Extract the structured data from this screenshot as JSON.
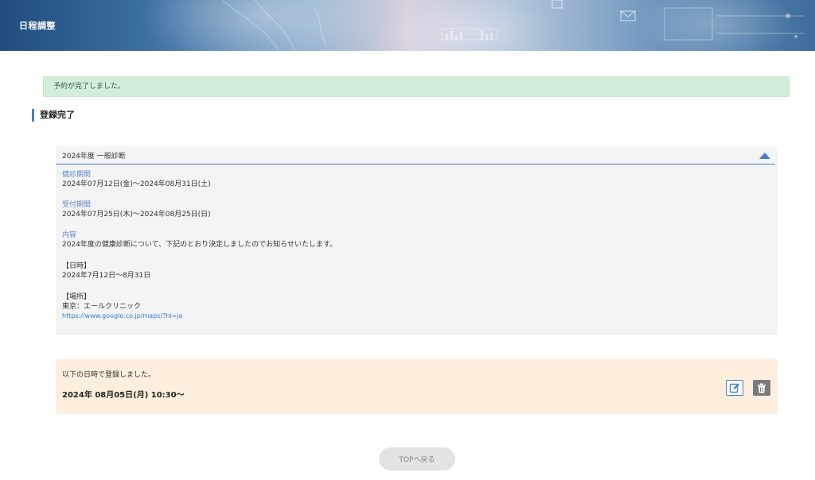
{
  "header": {
    "title": "日程調整"
  },
  "alert": {
    "message": "予約が完了しました。"
  },
  "section": {
    "title": "登録完了"
  },
  "schedule": {
    "title": "2024年度 一般診断",
    "exam_period": {
      "label": "健診期間",
      "value": "2024年07月12日(金)～2024年08月31日(土)"
    },
    "reception_period": {
      "label": "受付期間",
      "value": "2024年07月25日(木)～2024年08月25日(日)"
    },
    "content": {
      "label": "内容",
      "intro": "2024年度の健康診断について、下記のとおり決定しましたのでお知らせいたします。",
      "datetime_heading": "【日時】",
      "datetime_value": "2024年7月12日～8月31日",
      "place_heading": "【場所】",
      "place_value": "東京：エールクリニック",
      "place_link": "https://www.google.co.jp/maps/?hl=ja"
    }
  },
  "registration": {
    "note": "以下の日時で登録しました。",
    "datetime": "2024年 08月05日(月) 10:30～"
  },
  "buttons": {
    "top": "TOPへ戻る"
  },
  "colors": {
    "accent": "#4a7ec2",
    "alert_bg": "#d4edda",
    "registration_bg": "#fdeede"
  },
  "icons": {
    "collapse": "triangle-up-icon",
    "edit": "edit-icon",
    "delete": "trash-icon"
  }
}
